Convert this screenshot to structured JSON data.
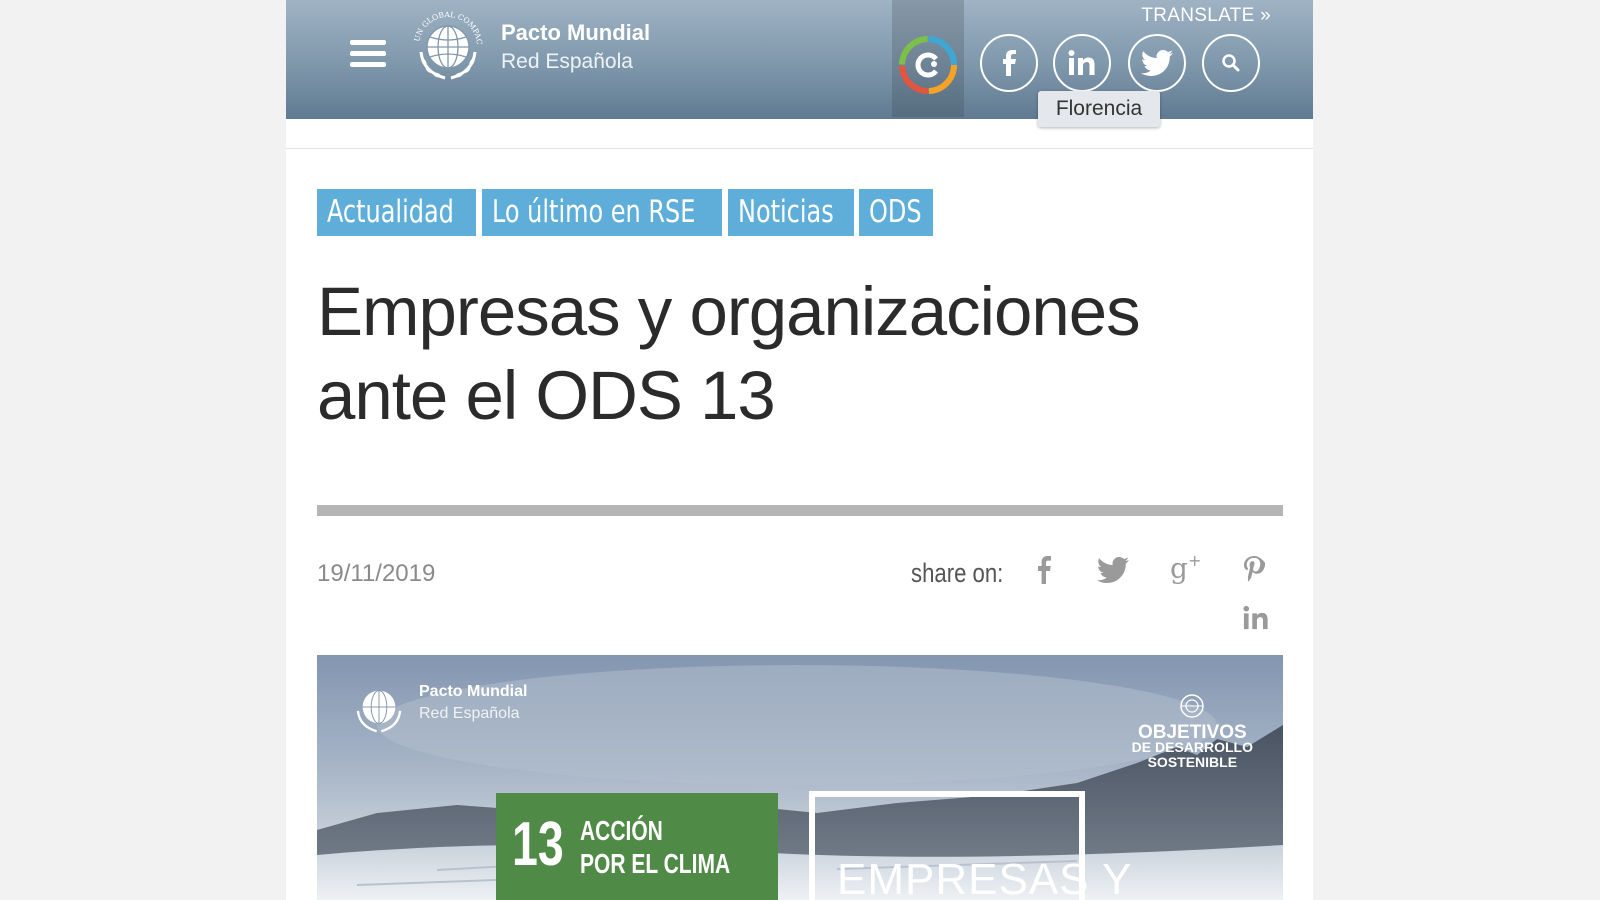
{
  "header": {
    "brand_name": "Pacto Mundial",
    "brand_sub": "Red Española",
    "translate_label": "TRANSLATE »",
    "tooltip": "Florencia",
    "social_icons": [
      "facebook-icon",
      "linkedin-icon",
      "twitter-icon",
      "search-icon"
    ]
  },
  "categories": [
    "Actualidad",
    "Lo último en RSE",
    "Noticias",
    "ODS"
  ],
  "article": {
    "title_line1": "Empresas y organizaciones",
    "title_line2": "ante el ODS 13",
    "date": "19/11/2019",
    "share_label": "share on:"
  },
  "hero": {
    "brand_name": "Pacto Mundial",
    "brand_sub": "Red Española",
    "ods_line1": "OBJETIVOS",
    "ods_line2": "DE DESARROLLO",
    "ods_line3": "SOSTENIBLE",
    "goal_number": "13",
    "goal_line1": "ACCIÓN",
    "goal_line2": "POR EL CLIMA",
    "frame_text": "EMPRESAS Y"
  },
  "colors": {
    "category_bg": "#5eaed9",
    "header_top": "#9fb3c4",
    "header_bottom": "#5f7a91",
    "goal13_green": "#4f8a46"
  }
}
